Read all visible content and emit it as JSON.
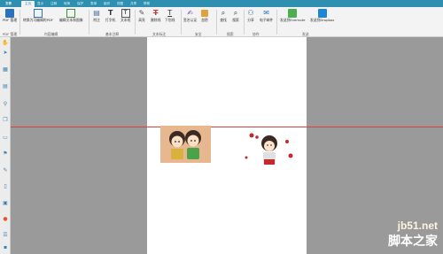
{
  "tabs": {
    "file": "文件",
    "items": [
      "主页",
      "显示",
      "注释",
      "转换",
      "保护",
      "表单",
      "组织",
      "视图",
      "共享",
      "帮助"
    ],
    "active_index": 0
  },
  "ribbon": {
    "groups": [
      {
        "label": "PDF 管理",
        "buttons": [
          "PDF 管理"
        ]
      },
      {
        "label": "内容编辑",
        "buttons": [
          "转换为可编辑的PDF",
          "编辑文本和图像"
        ]
      },
      {
        "label": "基本注释",
        "buttons": [
          "附注",
          "打字机",
          "文本框"
        ]
      },
      {
        "label": "文本标注",
        "buttons": [
          "高亮",
          "删除线",
          "下划线"
        ]
      },
      {
        "label": "安全",
        "buttons": [
          "签名认证",
          "加密"
        ]
      },
      {
        "label": "搜索",
        "buttons": [
          "查找",
          "搜索"
        ]
      },
      {
        "label": "协作",
        "buttons": [
          "分享",
          "电子邮件"
        ]
      },
      {
        "label": "发送",
        "buttons": [
          "发送到Evernote",
          "发送到Dropbox"
        ]
      }
    ]
  },
  "watermark": {
    "line1": "jb51.net",
    "line2": "脚本之家"
  },
  "colors": {
    "tabbar": "#2f8fb0",
    "separator_line": "#d94040",
    "workspace": "#9a9a9a"
  }
}
